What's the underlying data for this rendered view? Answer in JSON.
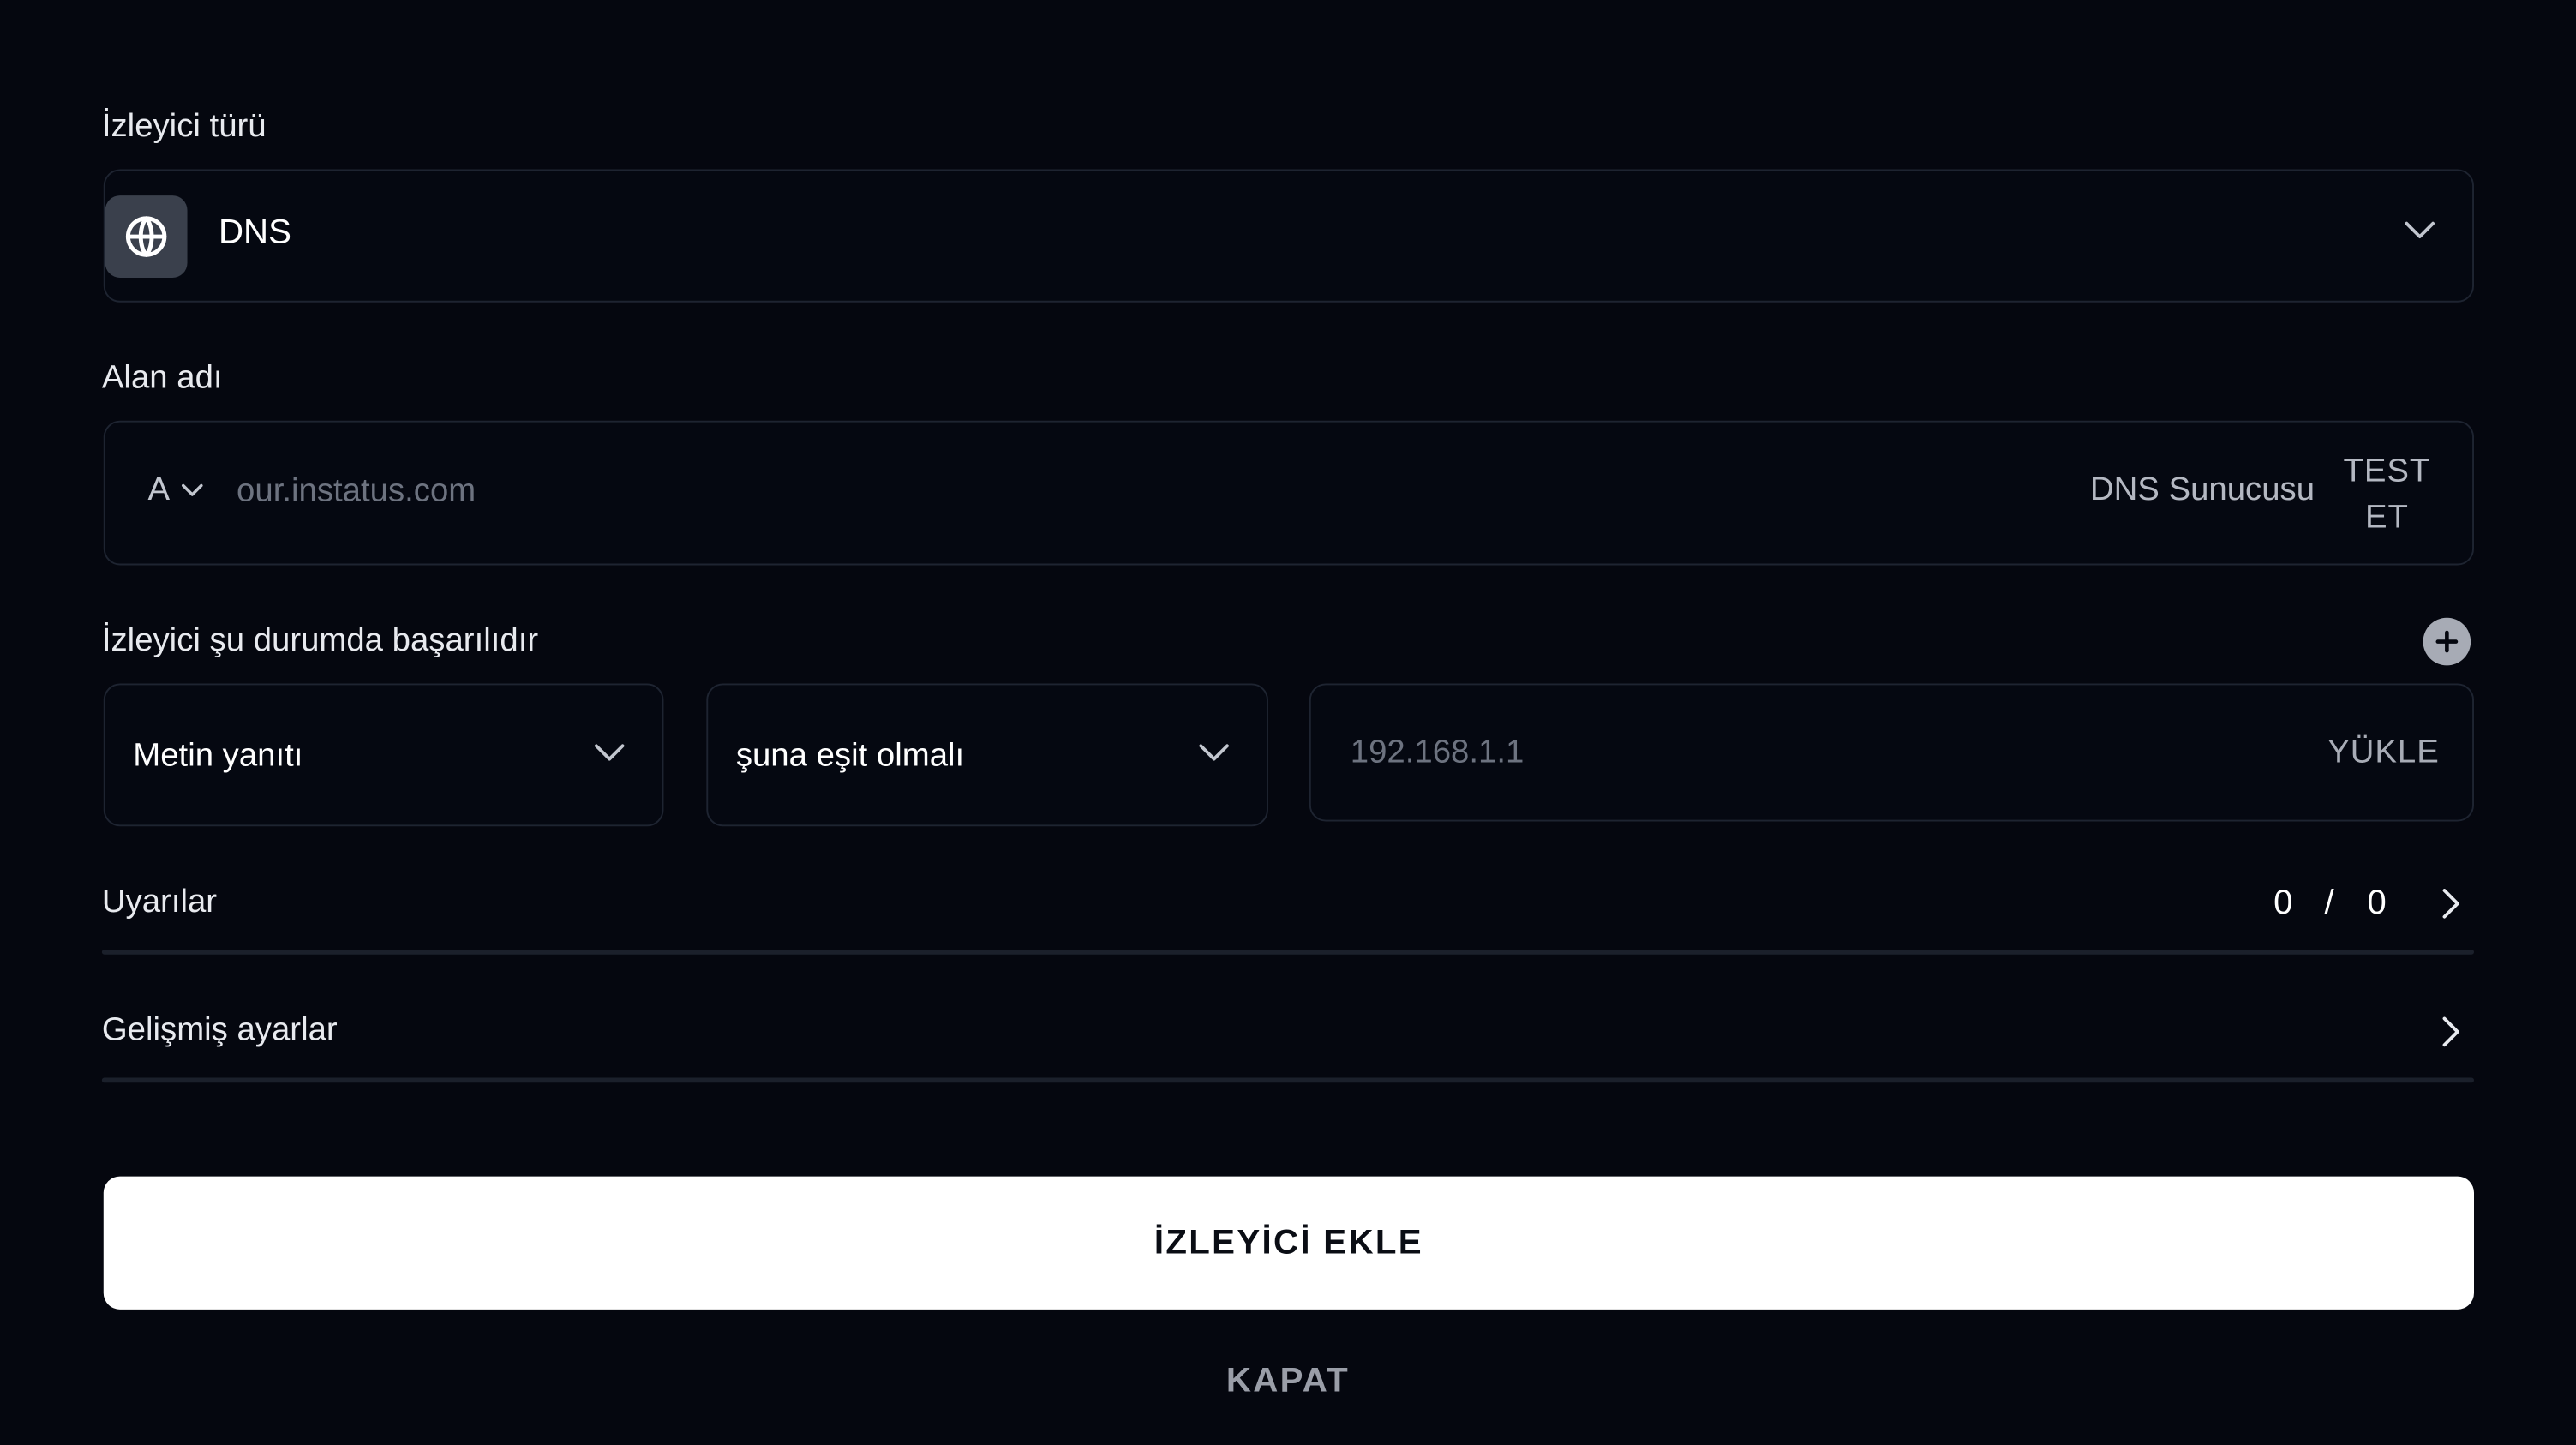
{
  "monitor_type": {
    "label": "İzleyici türü",
    "value": "DNS",
    "icon": "globe-icon"
  },
  "domain": {
    "label": "Alan adı",
    "record_type": "A",
    "placeholder": "our.instatus.com",
    "value": "",
    "dns_server_label": "DNS Sunucusu",
    "test_button_line1": "TEST",
    "test_button_line2": "ET"
  },
  "success_condition": {
    "label": "İzleyici şu durumda başarılıdır",
    "add_icon": "plus-icon",
    "field_select": "Metin yanıtı",
    "operator_select": "şuna eşit olmalı",
    "value_placeholder": "192.168.1.1",
    "value": "",
    "upload_label": "YÜKLE"
  },
  "alerts": {
    "label": "Uyarılar",
    "active": "0",
    "separator": "/",
    "total": "0"
  },
  "advanced": {
    "label": "Gelişmiş ayarlar"
  },
  "actions": {
    "add_monitor": "İZLEYİCİ EKLE",
    "close": "KAPAT"
  },
  "colors": {
    "background": "#05070f",
    "border": "#1e2431",
    "primary_button": "#ffffff",
    "icon_tile": "#3a404c"
  }
}
